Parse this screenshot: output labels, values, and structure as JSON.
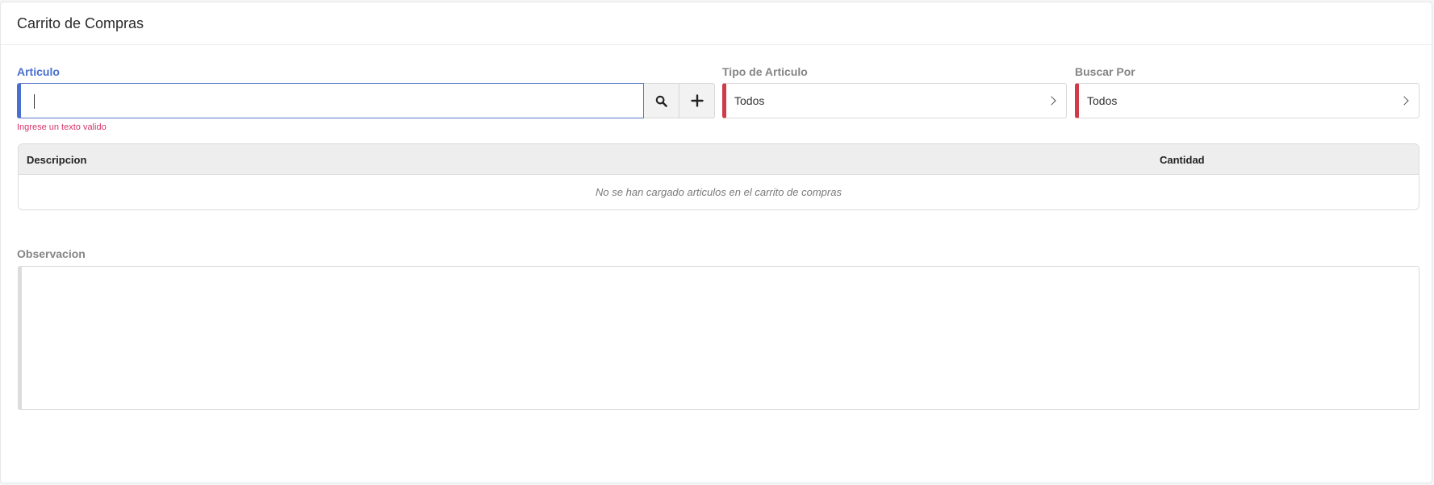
{
  "header": {
    "title": "Carrito de Compras"
  },
  "articulo": {
    "label": "Articulo",
    "value": "",
    "error": "Ingrese un texto valido"
  },
  "tipo_articulo": {
    "label": "Tipo de Articulo",
    "selected": "Todos"
  },
  "buscar_por": {
    "label": "Buscar Por",
    "selected": "Todos"
  },
  "cart_table": {
    "columns": [
      "Descripcion",
      "Cantidad"
    ],
    "empty_message": "No se han cargado articulos en el carrito de compras"
  },
  "observacion": {
    "label": "Observacion",
    "value": ""
  },
  "icons": {
    "search": "search-icon",
    "add": "plus-icon",
    "chevron": "chevron-right-icon"
  },
  "colors": {
    "accent": "#4a6fd0",
    "required": "#d13a4b",
    "error": "#d6336c"
  }
}
